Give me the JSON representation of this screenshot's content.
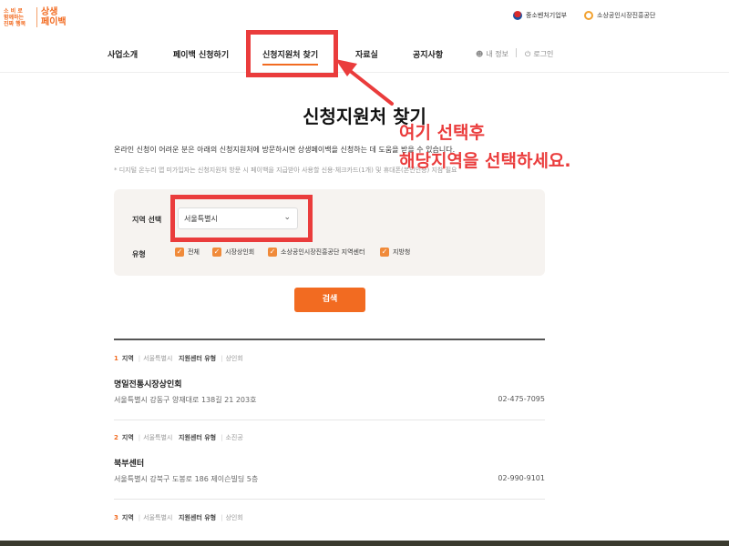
{
  "logo": {
    "slogan_line1": "소 비 로",
    "slogan_line2": "함께하는",
    "slogan_line3": "진짜 행복",
    "brand_line1": "상생",
    "brand_line2": "페이백"
  },
  "header": {
    "ministry1": "중소벤처기업부",
    "ministry2": "소상공인시장진흥공단"
  },
  "nav": {
    "items": [
      "사업소개",
      "페이백 신청하기",
      "신청지원처 찾기",
      "자료실",
      "공지사항"
    ],
    "my_info": "내 정보",
    "login": "로그인"
  },
  "annotation": {
    "line1": "여기 선택후",
    "line2": "해당지역을 선택하세요.",
    "color": "#ea3c3c"
  },
  "main": {
    "title": "신청지원처 찾기",
    "description": "온라인 신청이 어려운 분은 아래의 신청지원처에 방문하시면 상생페이백을 신청하는 데 도움을 받을 수 있습니다.",
    "note": "* 디지털 온누리 앱 미가입자는 신청지원처 방문 시 페이백을 지급받아 사용할 신용·체크카드(1개) 및 휴대폰(본인인증) 지참 필요"
  },
  "filter": {
    "region_label": "지역 선택",
    "region_value": "서울특별시",
    "type_label": "유형",
    "types": [
      "전체",
      "시장상인회",
      "소상공인시장진흥공단 지역센터",
      "지방청"
    ],
    "search_button": "검색"
  },
  "results": {
    "labels": {
      "region": "지역",
      "center_type": "지원센터 유형"
    },
    "items": [
      {
        "num": "1",
        "region": "서울특별시",
        "type": "상인회",
        "name": "명일전통시장상인회",
        "address": "서울특별시 강동구 양재대로 138길 21 203호",
        "phone": "02-475-7095"
      },
      {
        "num": "2",
        "region": "서울특별시",
        "type": "소진공",
        "name": "북부센터",
        "address": "서울특별시 강북구 도봉로 186 제이슨빌딩 5층",
        "phone": "02-990-9101"
      },
      {
        "num": "3",
        "region": "서울특별시",
        "type": "상인회",
        "name": "",
        "address": "",
        "phone": ""
      }
    ]
  },
  "colors": {
    "accent": "#f26b21",
    "checkbox": "#f08a3a",
    "filter_bg": "#f6f3f0"
  }
}
